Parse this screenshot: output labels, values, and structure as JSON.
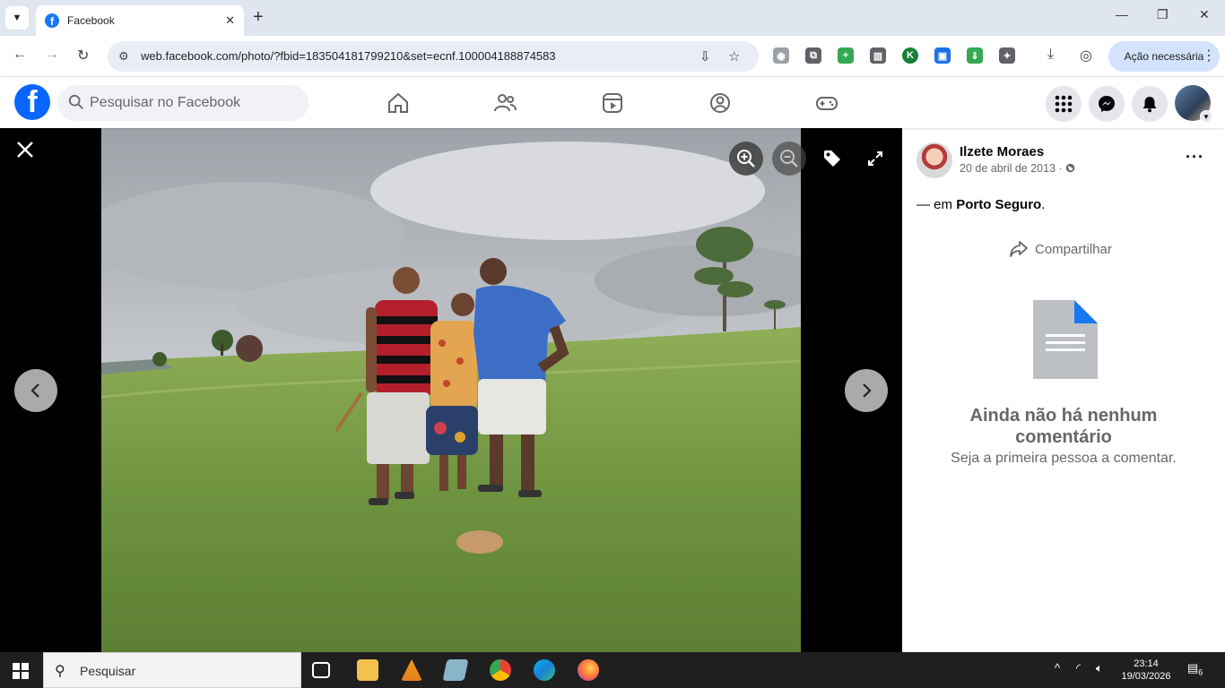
{
  "browser": {
    "tab_title": "Facebook",
    "url": "web.facebook.com/photo/?fbid=183504181799210&set=ecnf.100004188874583",
    "action_button": "Ação necessária"
  },
  "facebook": {
    "logo": "f",
    "search_placeholder": "Pesquisar no Facebook",
    "nav_icons": [
      "home-icon",
      "friends-icon",
      "video-icon",
      "groups-icon",
      "gaming-icon"
    ],
    "brand_color": "#0866ff"
  },
  "post": {
    "author": "Ilzete Moraes",
    "date": "20 de abril de 2013",
    "privacy_separator": "·",
    "location_prefix": "— em",
    "location": "Porto Seguro",
    "location_suffix": ".",
    "share_label": "Compartilhar",
    "more": "···",
    "no_comments_title": "Ainda não há nenhum comentário",
    "no_comments_sub": "Seja a primeira pessoa a comentar."
  },
  "taskbar": {
    "search_label": "Pesquisar",
    "time": "23:14",
    "date": "19/03/2026",
    "notifications": "6"
  }
}
